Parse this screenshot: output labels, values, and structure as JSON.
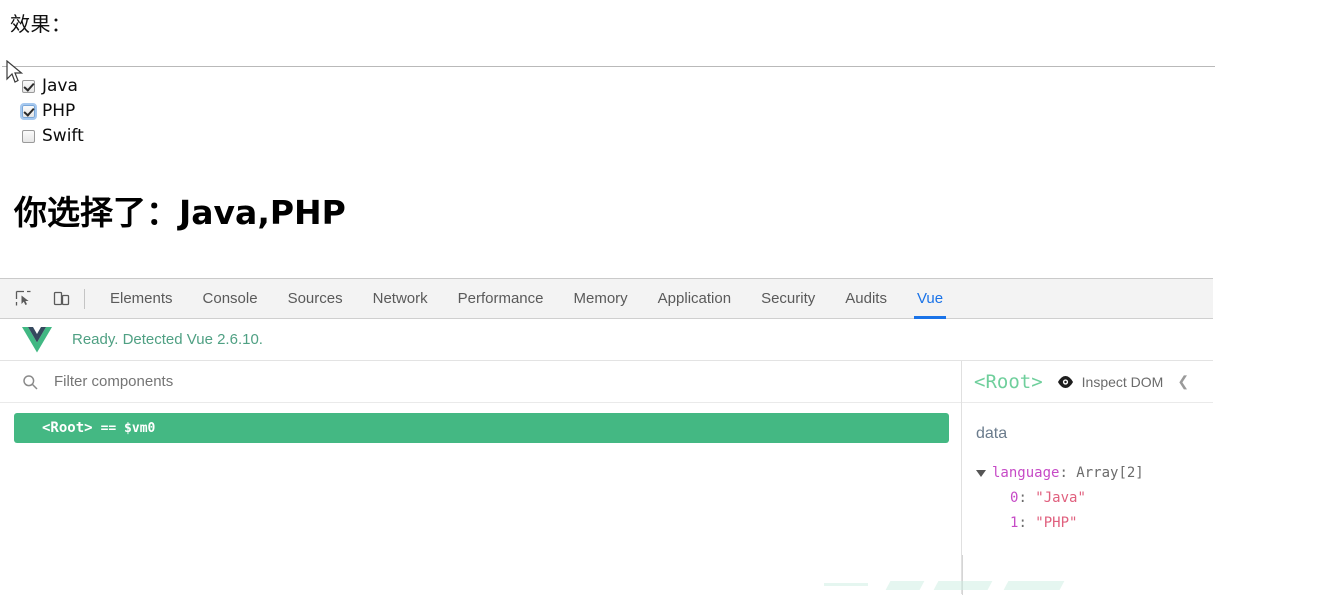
{
  "preview": {
    "doc_label": "效果：",
    "checkboxes": [
      {
        "label": "Java",
        "checked": true,
        "focused": false
      },
      {
        "label": "PHP",
        "checked": true,
        "focused": true
      },
      {
        "label": "Swift",
        "checked": false,
        "focused": false
      }
    ],
    "result_heading": "你选择了：Java,PHP"
  },
  "devtools": {
    "icons": {
      "inspect": "inspect-element-icon",
      "device": "device-toolbar-icon"
    },
    "tabs": [
      {
        "label": "Elements",
        "active": false
      },
      {
        "label": "Console",
        "active": false
      },
      {
        "label": "Sources",
        "active": false
      },
      {
        "label": "Network",
        "active": false
      },
      {
        "label": "Performance",
        "active": false
      },
      {
        "label": "Memory",
        "active": false
      },
      {
        "label": "Application",
        "active": false
      },
      {
        "label": "Security",
        "active": false
      },
      {
        "label": "Audits",
        "active": false
      },
      {
        "label": "Vue",
        "active": true
      }
    ],
    "active_tab_color": "#1a73e8"
  },
  "vue_panel": {
    "status_text": "Ready. Detected Vue 2.6.10.",
    "status_color": "#4fa083",
    "filter": {
      "placeholder": "Filter components",
      "value": ""
    },
    "tree": {
      "selected_row": {
        "name": "<Root>",
        "vm": "== $vm0",
        "highlight_color": "#44b883"
      }
    },
    "inspector": {
      "title": "<Root>",
      "title_color": "#6fcf9c",
      "inspect_dom_label": "Inspect DOM",
      "eye_icon": "eye-icon",
      "extra_icon": "more-icon",
      "data_title": "data",
      "data_rows": [
        {
          "indent": 0,
          "expandable": true,
          "key": "language",
          "sep": ": ",
          "value": "Array[2]",
          "value_kind": "type"
        },
        {
          "indent": 1,
          "expandable": false,
          "key": "0",
          "sep": ": ",
          "value": "\"Java\"",
          "value_kind": "string"
        },
        {
          "indent": 1,
          "expandable": false,
          "key": "1",
          "sep": ": ",
          "value": "\"PHP\"",
          "value_kind": "string"
        }
      ]
    }
  }
}
